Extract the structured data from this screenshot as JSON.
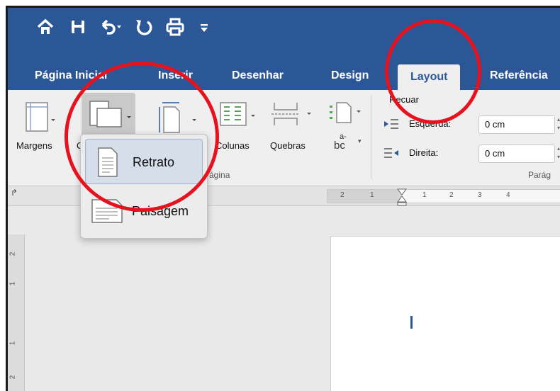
{
  "quick_access": {
    "home_icon": "home-icon",
    "save_icon": "save-icon",
    "undo_icon": "undo-icon",
    "redo_icon": "redo-icon",
    "print_icon": "print-icon",
    "customize_icon": "customize-icon"
  },
  "tabs": [
    {
      "label": "Página Inicial"
    },
    {
      "label": "Inserir"
    },
    {
      "label": "Desenhar"
    },
    {
      "label": "Design"
    },
    {
      "label": "Layout",
      "active": true
    },
    {
      "label": "Referência"
    }
  ],
  "ribbon": {
    "margins_label": "Margens",
    "orientation_partial": "O",
    "columns_label": "Colunas",
    "breaks_label": "Quebras",
    "hyphenation_label": "bc",
    "hyphenation_sup": "a-",
    "page_group_caption": "Página",
    "indent_title": "Recuar",
    "indent_left_label": "Esquerda:",
    "indent_left_value": "0 cm",
    "indent_right_label": "Direita:",
    "indent_right_value": "0 cm",
    "paragraph_caption": "Parág"
  },
  "ruler": {
    "ticks": [
      "2",
      "1",
      "1",
      "2",
      "3",
      "4"
    ],
    "vticks": [
      "2",
      "1",
      "1",
      "2"
    ]
  },
  "orientation_menu": {
    "items": [
      {
        "label": "Retrato",
        "selected": true
      },
      {
        "label": "Paisagem",
        "selected": false
      }
    ]
  },
  "colors": {
    "brand": "#2b5797",
    "annotation": "#e8121e"
  }
}
